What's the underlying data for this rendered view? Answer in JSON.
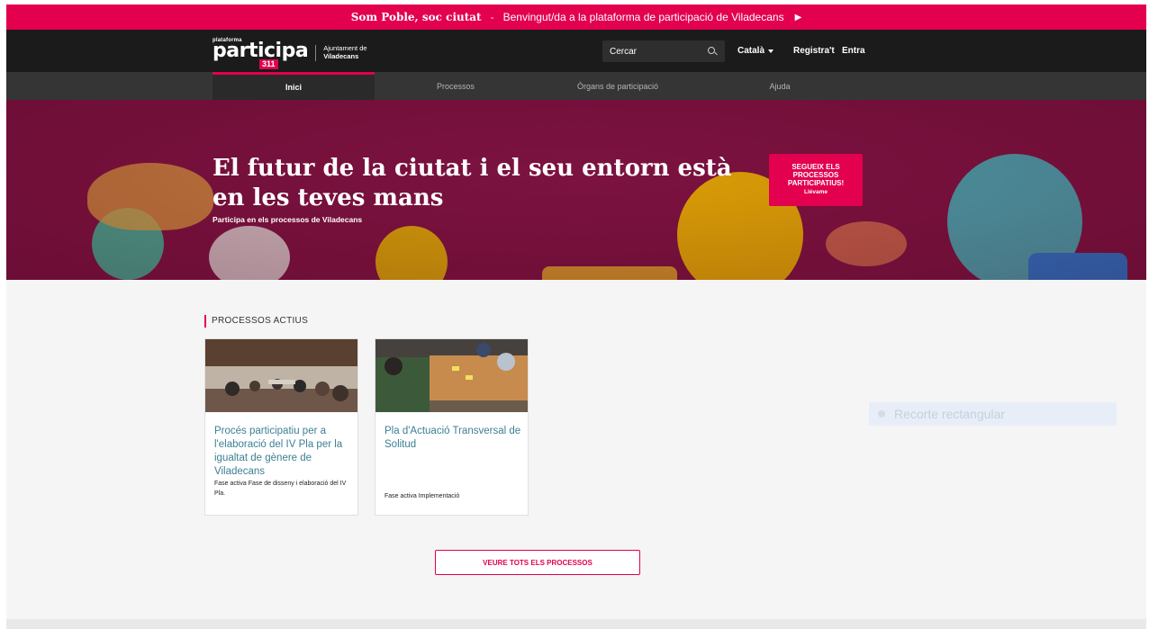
{
  "announcement": {
    "bold": "Som Poble, soc ciutat",
    "separator": "-",
    "message": "Benvingut/da a la plataforma de participació de Viladecans",
    "arrow": "▶"
  },
  "header": {
    "logo_small": "plataforma",
    "logo_word": "participa",
    "logo_number": "311",
    "org_line1": "Ajuntament de",
    "org_line2": "Viladecans",
    "search_placeholder": "Cercar",
    "language": "Català",
    "register": "Registra't",
    "login": "Entra"
  },
  "nav": {
    "tabs": [
      {
        "label": "Inici",
        "active": true
      },
      {
        "label": "Processos",
        "active": false
      },
      {
        "label": "Òrgans de participació",
        "active": false
      },
      {
        "label": "Ajuda",
        "active": false
      }
    ]
  },
  "hero": {
    "title": "El futur de la ciutat i el seu entorn està en les teves mans",
    "subtitle": "Participa en els processos de Viladecans",
    "cta_line1": "SEGUEIX ELS PROCESSOS PARTICIPATIUS!",
    "cta_line2": "Llévame"
  },
  "section": {
    "title": "PROCESSOS ACTIUS",
    "cards": [
      {
        "title": "Procés participatiu per a l'elaboració del IV Pla per la igualtat de gènere de Viladecans",
        "phase": "Fase activa Fase de disseny i elaboració del IV Pla."
      },
      {
        "title": "Pla d'Actuació Transversal de Solitud",
        "phase": "Fase activa Implementació"
      }
    ],
    "view_all": "VEURE TOTS ELS PROCESSOS"
  },
  "overlay": {
    "label": "Recorte rectangular"
  },
  "colors": {
    "accent": "#e2004f",
    "header_bg": "#1b1b1b",
    "nav_bg": "#353535",
    "hero_bg": "#7c1240",
    "link": "#3c7f93"
  }
}
